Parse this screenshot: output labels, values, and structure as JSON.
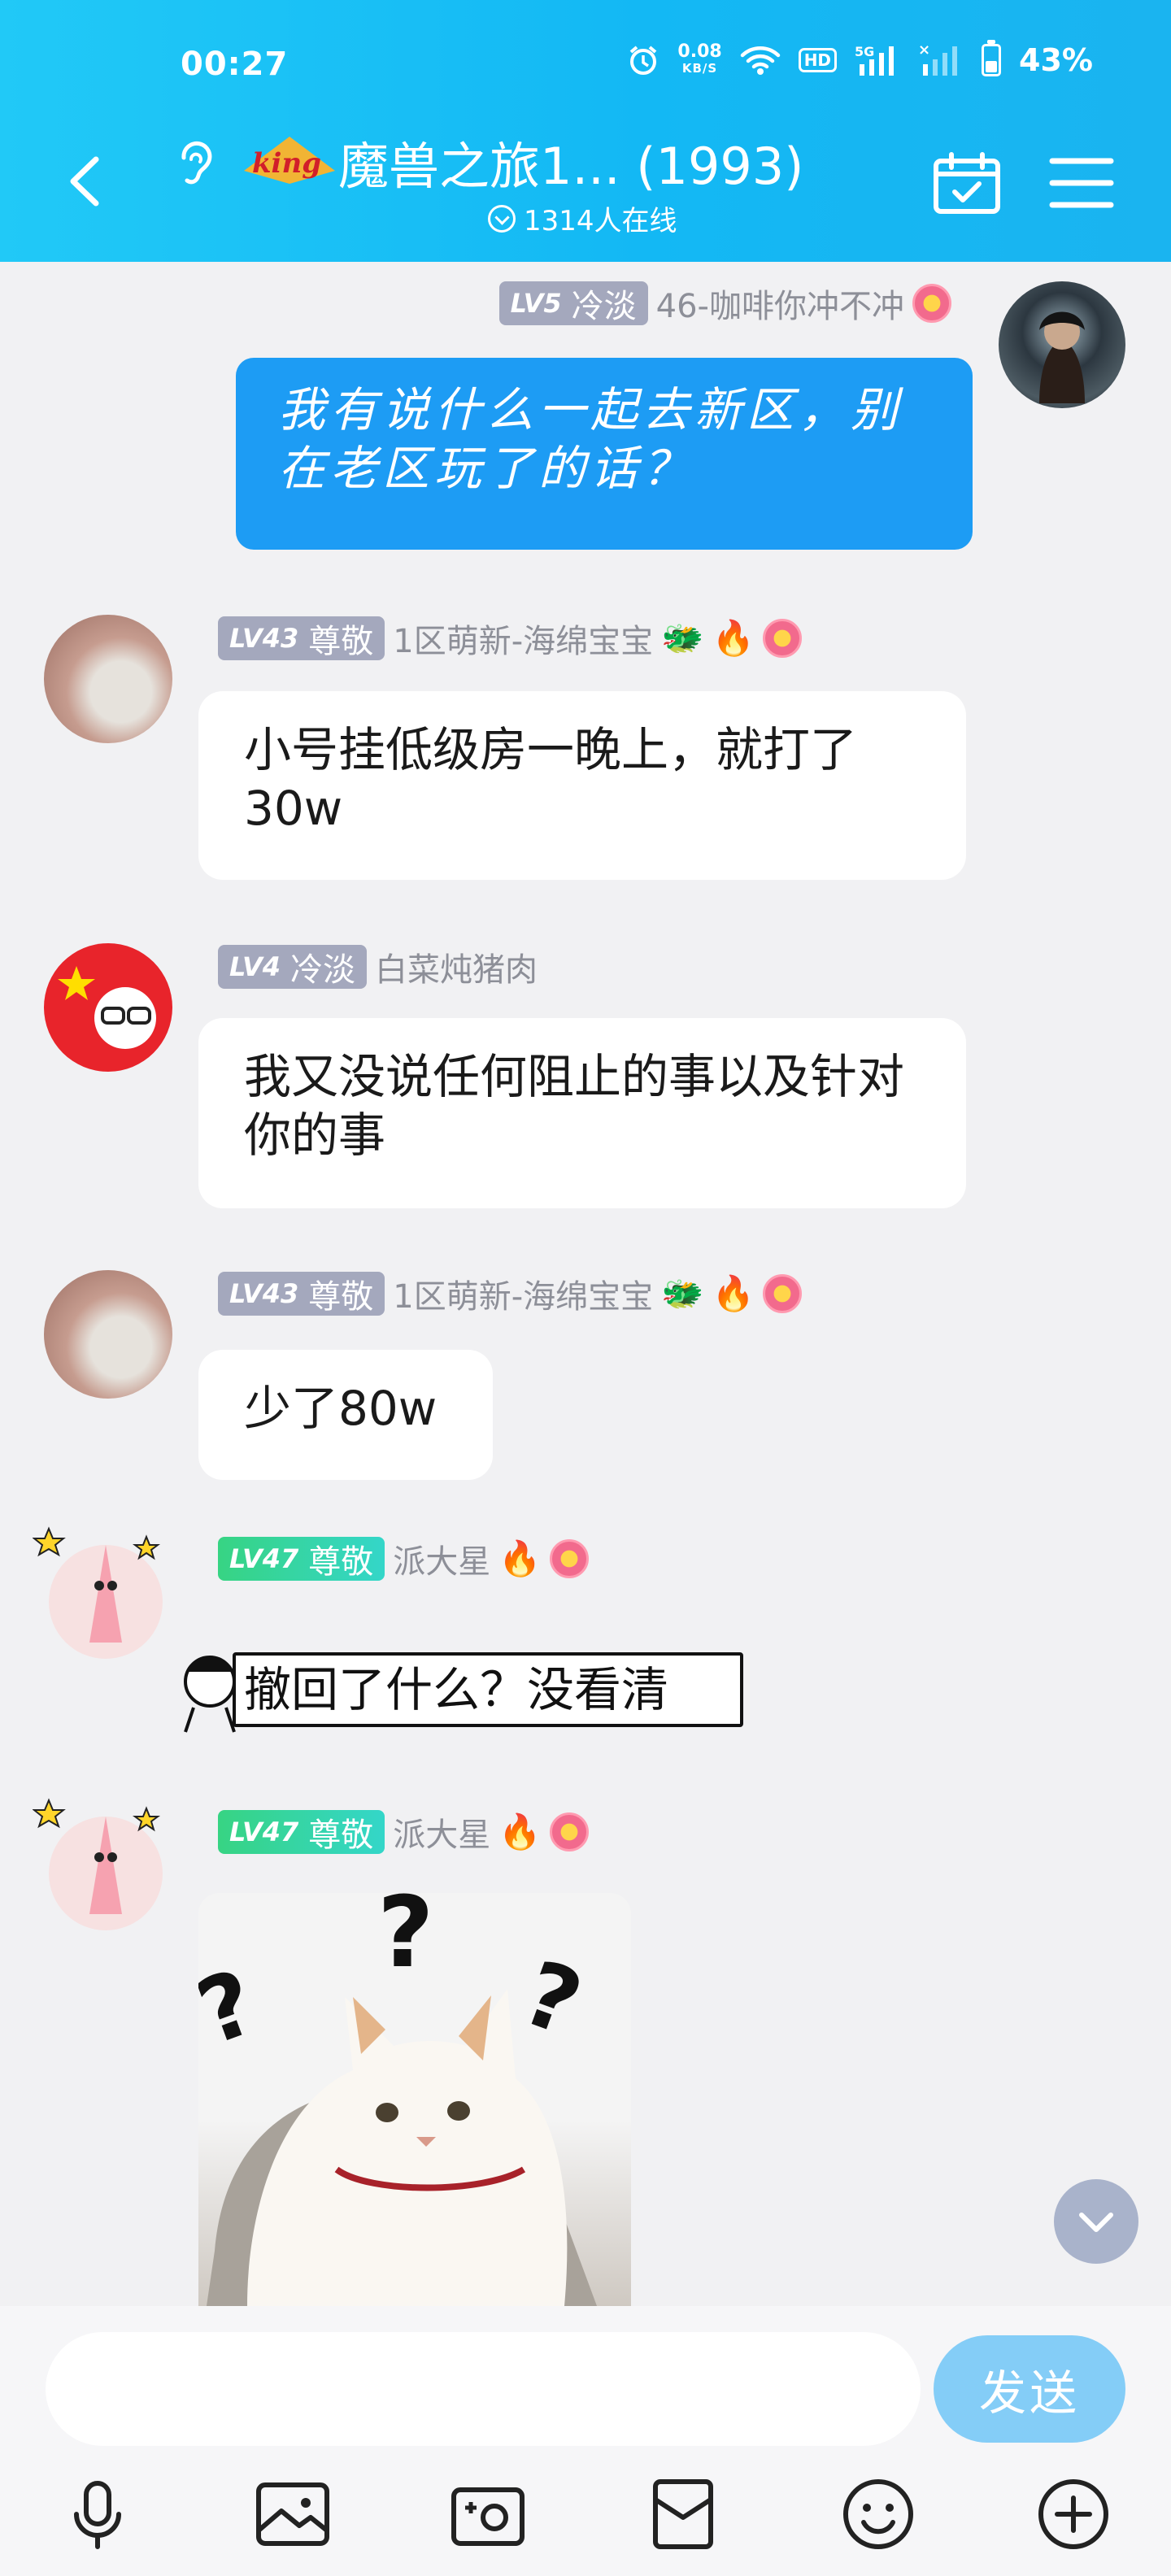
{
  "status": {
    "time": "00:27",
    "speed_value": "0.08",
    "speed_unit": "KB/S",
    "hd": "HD",
    "net": "5G",
    "battery": "43%"
  },
  "header": {
    "title": "魔兽之旅1... (1993)",
    "online": "1314人在线"
  },
  "messages": [
    {
      "level": "LV5",
      "rank": "冷淡",
      "sender": "46-咖啡你冲不冲",
      "text": "我有说什么一起去新区，别在老区玩了的话？",
      "mine": true
    },
    {
      "level": "LV43",
      "rank": "尊敬",
      "sender": "1区萌新-海绵宝宝",
      "text": "小号挂低级房一晚上，就打了30w"
    },
    {
      "level": "LV4",
      "rank": "冷淡",
      "sender": "白菜炖猪肉",
      "text": "我又没说任何阻止的事以及针对你的事"
    },
    {
      "level": "LV43",
      "rank": "尊敬",
      "sender": "1区萌新-海绵宝宝",
      "text": "少了80w"
    },
    {
      "level": "LV47",
      "rank": "尊敬",
      "sender": "派大星",
      "text": "撤回了什么？没看清"
    },
    {
      "level": "LV47",
      "rank": "尊敬",
      "sender": "派大星",
      "text": ""
    }
  ],
  "input": {
    "placeholder": "",
    "send_label": "发送"
  },
  "toolbar": [
    "mic-icon",
    "image-icon",
    "camera-icon",
    "red-packet-icon",
    "emoji-icon",
    "plus-icon"
  ],
  "colors": {
    "header": "#13b8f4",
    "my_bubble": "#1d9cf4",
    "send_button": "#84cdf7"
  }
}
